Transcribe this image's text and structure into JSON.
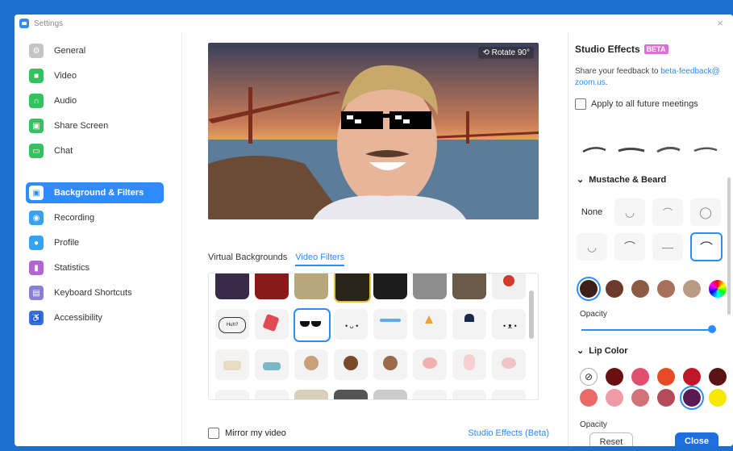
{
  "window": {
    "title": "Settings",
    "close_glyph": "×"
  },
  "sidebar": {
    "items": [
      {
        "label": "General",
        "icon": "gear-icon",
        "color": "#b9b9b9"
      },
      {
        "label": "Video",
        "icon": "video-camera-icon",
        "color": "#35c15f"
      },
      {
        "label": "Audio",
        "icon": "headphones-icon",
        "color": "#35c15f"
      },
      {
        "label": "Share Screen",
        "icon": "share-screen-icon",
        "color": "#35c15f"
      },
      {
        "label": "Chat",
        "icon": "chat-bubble-icon",
        "color": "#35c15f"
      },
      {
        "label": "Background & Filters",
        "icon": "background-person-icon",
        "color": "#ffffff"
      },
      {
        "label": "Recording",
        "icon": "record-icon",
        "color": "#3aa0f0"
      },
      {
        "label": "Profile",
        "icon": "profile-icon",
        "color": "#3aa0f0"
      },
      {
        "label": "Statistics",
        "icon": "bar-chart-icon",
        "color": "#b365d6"
      },
      {
        "label": "Keyboard Shortcuts",
        "icon": "keyboard-icon",
        "color": "#8a7fd6"
      },
      {
        "label": "Accessibility",
        "icon": "accessibility-icon",
        "color": "#3a6fd8"
      }
    ],
    "active_index": 5
  },
  "main": {
    "rotate_label": "Rotate 90°",
    "tabs": [
      {
        "label": "Virtual Backgrounds"
      },
      {
        "label": "Video Filters"
      }
    ],
    "active_tab": 1,
    "filters": [
      "tv-lights-filter",
      "theater-curtain-filter",
      "retro-tv-filter",
      "lightbulb-frame-filter",
      "pearl-frame-filter",
      "camera-viewfinder-filter",
      "old-tv-filter",
      "medal-ribbon-filter",
      "speech-bubble-filter",
      "red-heart-filter",
      "sunglasses-filter",
      "sprout-face-filter",
      "headband-filter",
      "pizza-face-filter",
      "chef-hat-filter",
      "cute-face-filter",
      "mask-face-filter",
      "surgical-mask-filter",
      "bear-ears-filter",
      "brown-bear-filter",
      "reindeer-filter",
      "pig-nose-filter",
      "bunny-ears-filter",
      "mouse-ears-filter"
    ],
    "selected_filter": 10,
    "mirror_label": "Mirror my video",
    "studio_effects_link": "Studio Effects (Beta)"
  },
  "panel": {
    "title": "Studio Effects",
    "badge": "BETA",
    "feedback_text": "Share your feedback to ",
    "feedback_link": "beta-feedback@ zoom.us",
    "feedback_end": ".",
    "apply_label": "Apply to all future meetings",
    "mustache": {
      "title": "Mustache & Beard",
      "none_label": "None",
      "selected_index": 7,
      "colors": [
        "#3b1f18",
        "#6b3a2a",
        "#8a5a44",
        "#a8705a",
        "#b99a82"
      ],
      "selected_color": 0
    },
    "opacity_label": "Opacity",
    "opacity_value": 1.0,
    "lip": {
      "title": "Lip Color",
      "colors": [
        "#6a0f0f",
        "#e0506e",
        "#e84a24",
        "#c0162a",
        "#5a1414",
        "#ea6a6a",
        "#f09aa8",
        "#d2737a",
        "#b44a5a",
        "#5a1a52",
        "#f6e800"
      ],
      "selected_color": 9
    },
    "opacity_label2": "Opacity",
    "reset_label": "Reset",
    "close_label": "Close"
  }
}
